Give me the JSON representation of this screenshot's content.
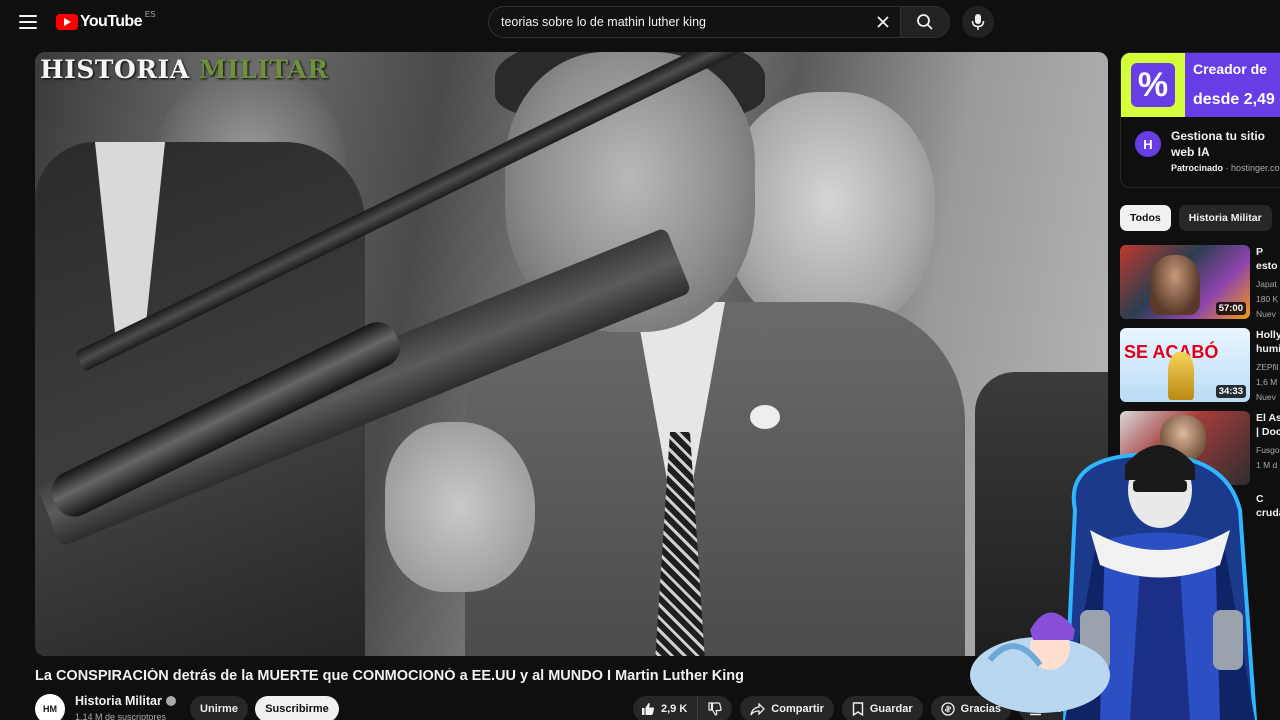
{
  "header": {
    "logo_text": "YouTube",
    "country_code": "ES",
    "search_value": "teorias sobre lo de mathin luther king",
    "icons": [
      "menu-icon",
      "youtube-logo-icon",
      "clear-icon",
      "search-icon",
      "mic-icon"
    ]
  },
  "player": {
    "watermark_part1": "HISTORIA ",
    "watermark_part2": "MILITAR"
  },
  "video": {
    "title": "La CONSPIRACIÓN detrás de la MUERTE que CONMOCIONÓ a EE.UU y al MUNDO I Martin Luther King",
    "channel_name": "Historia Militar",
    "channel_avatar_text": "HM",
    "subscribers": "1,14 M de suscriptores",
    "join_label": "Unirme",
    "subscribe_label": "Suscribirme",
    "likes": "2,9 K",
    "share_label": "Compartir",
    "save_label": "Guardar",
    "thanks_label": "Gracias",
    "download_label": "Descargar"
  },
  "ad": {
    "logo_symbol": "%",
    "headline1": "Creador de",
    "headline2": "desde 2,49",
    "icon_letter": "H",
    "description": "Gestiona tu sitio web IA",
    "sponsored": "Patrocinado",
    "domain": "hostinger.co"
  },
  "chips": [
    {
      "label": "Todos",
      "active": true
    },
    {
      "label": "Historia Militar",
      "active": false
    }
  ],
  "recommendations": [
    {
      "title_line1": "P",
      "title_line2": "esto",
      "channel": "Japat",
      "views": "180 K",
      "badge": "Nuev",
      "duration": "57:00"
    },
    {
      "title_line1": "Holly",
      "title_line2": "humi",
      "channel": "ZEPfil",
      "views": "1,6 M",
      "badge": "Nuev",
      "duration": "34:33",
      "thumb_text": "SE ACABÓ"
    },
    {
      "title_line1": "El As",
      "title_line2": "| Doc",
      "channel": "Fusgo",
      "views": "1 M d",
      "badge": ""
    },
    {
      "title_line1": "C",
      "title_line2": "cruda"
    }
  ],
  "colors": {
    "background": "#0f0f0f",
    "accent_red": "#ff0000",
    "ad_purple": "#673de6",
    "ad_lime": "#d4ff3a"
  }
}
